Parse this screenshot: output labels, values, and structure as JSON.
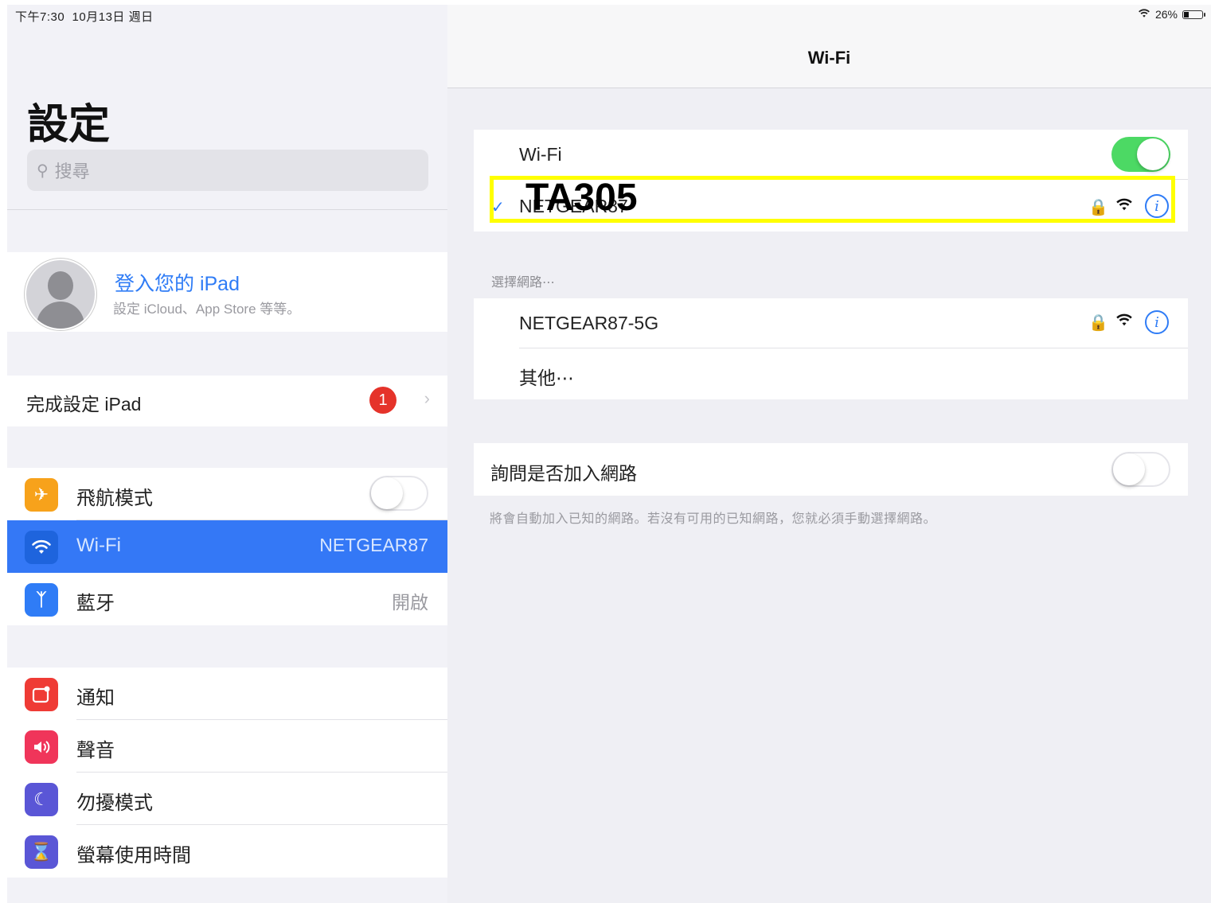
{
  "status_bar": {
    "time": "下午7:30",
    "date": "10月13日 週日",
    "battery": "26%"
  },
  "sidebar": {
    "title": "設定",
    "search_placeholder": "搜尋",
    "profile": {
      "title": "登入您的 iPad",
      "subtitle": "設定 iCloud、App Store 等等。"
    },
    "finish_setup": {
      "label": "完成設定 iPad",
      "badge": "1"
    },
    "group1": [
      {
        "label": "飛航模式",
        "icon": "airplane-icon",
        "color": "#f7a21b"
      },
      {
        "label": "Wi-Fi",
        "icon": "wifi-icon",
        "color": "#2f7cf6",
        "value": "NETGEAR87"
      },
      {
        "label": "藍牙",
        "icon": "bluetooth-icon",
        "color": "#2f7cf6",
        "value": "開啟"
      }
    ],
    "group2": [
      {
        "label": "通知",
        "icon": "notifications-icon",
        "color": "#ef3b35"
      },
      {
        "label": "聲音",
        "icon": "sound-icon",
        "color": "#f0355a"
      },
      {
        "label": "勿擾模式",
        "icon": "moon-icon",
        "color": "#5a56d6"
      },
      {
        "label": "螢幕使用時間",
        "icon": "hourglass-icon",
        "color": "#5a56d6"
      }
    ]
  },
  "main": {
    "nav_title": "Wi-Fi",
    "wifi_label": "Wi-Fi",
    "connected_network": "NETGEAR87",
    "section_header": "選擇網路⋯",
    "networks": [
      {
        "name": "NETGEAR87-5G"
      },
      {
        "name": "其他⋯"
      }
    ],
    "ask_join": "詢問是否加入網路",
    "footer": "將會自動加入已知的網路。若沒有可用的已知網路，您就必須手動選擇網路。"
  },
  "annotation": {
    "label": "TA305",
    "color": "#ffff00"
  }
}
